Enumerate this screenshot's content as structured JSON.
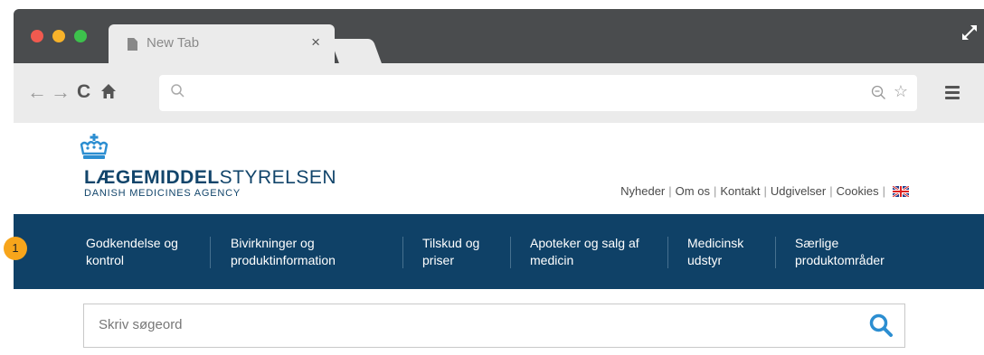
{
  "browser": {
    "tab_title": "New Tab",
    "tab_close": "×",
    "url_value": "",
    "colors": {
      "close": "#f15a4f",
      "minimize": "#f7b22a",
      "maximize": "#3dc14c"
    },
    "icons": [
      "page-icon",
      "close-icon",
      "fullscreen-icon",
      "back-arrow-icon",
      "forward-arrow-icon",
      "reload-icon",
      "home-icon",
      "search-icon",
      "zoom-out-icon",
      "bookmark-star-icon",
      "menu-icon"
    ]
  },
  "site": {
    "logo_text_bold": "LÆGEMIDDEL",
    "logo_text_light": "STYRELSEN",
    "logo_subtitle": "DANISH MEDICINES AGENCY",
    "top_links": [
      "Nyheder",
      "Om os",
      "Kontakt",
      "Udgivelser",
      "Cookies"
    ],
    "brand_color": "#0f4167",
    "nav": [
      {
        "line1": "Godkendelse og",
        "line2": "kontrol"
      },
      {
        "line1": "Bivirkninger og",
        "line2": "produktinformation"
      },
      {
        "line1": "Tilskud og",
        "line2": "priser"
      },
      {
        "line1": "Apoteker og salg af",
        "line2": "medicin"
      },
      {
        "line1": "Medicinsk",
        "line2": "udstyr"
      },
      {
        "line1": "Særlige",
        "line2": "produktområder"
      }
    ],
    "search_placeholder": "Skriv søgeord"
  },
  "annotation": {
    "marker": "1",
    "marker_color": "#f7a51b"
  }
}
